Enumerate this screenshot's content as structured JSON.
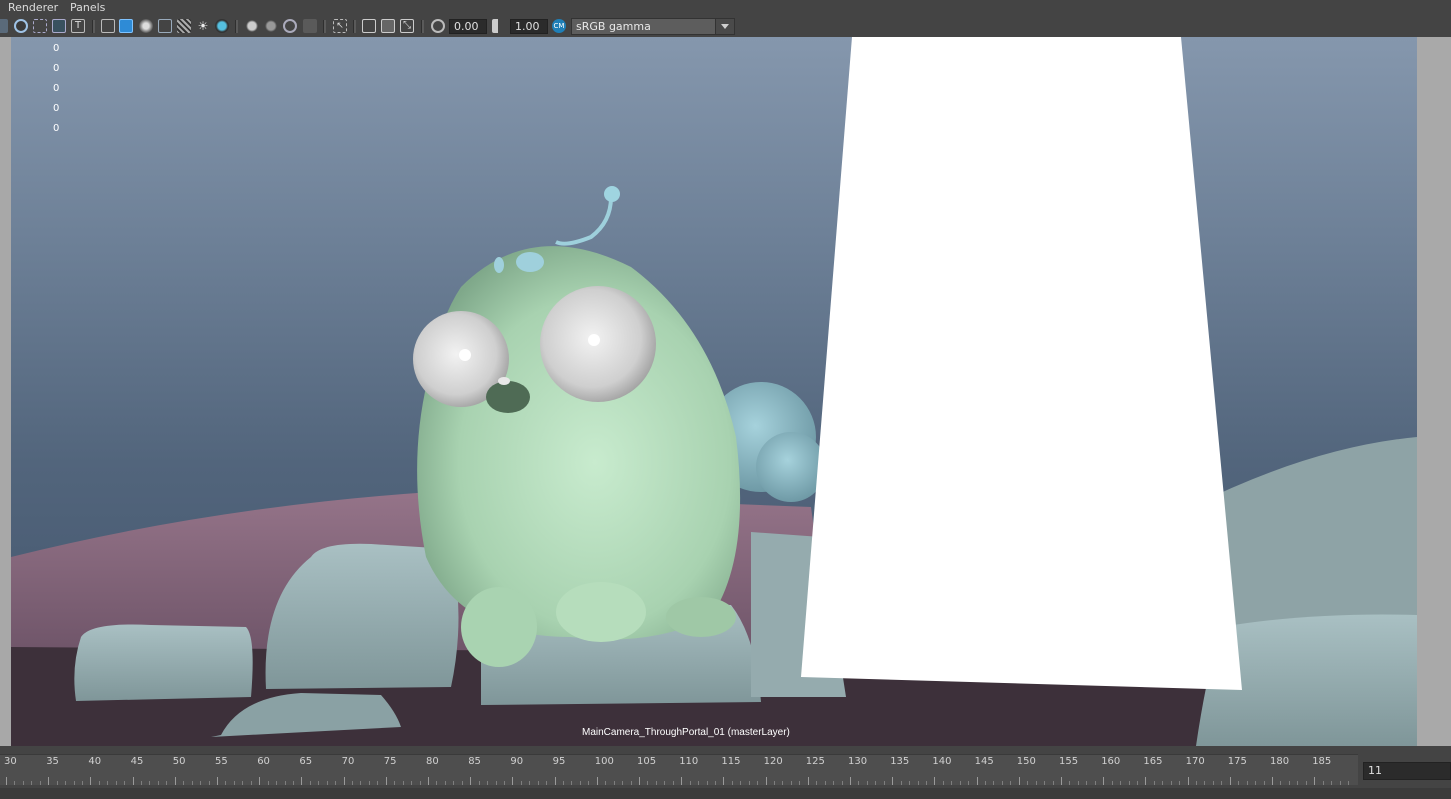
{
  "menu": {
    "items": [
      "Renderer",
      "Panels"
    ]
  },
  "toolbar": {
    "exposure_value": "0.00",
    "gamma_value": "1.00",
    "color_space": "sRGB gamma",
    "icons": [
      "view-transform-icon",
      "wireframe-icon",
      "smooth-shade-icon",
      "bounding-box-icon",
      "points-icon",
      "texture-icon",
      "default-material-icon",
      "xray-icon",
      "lights-icon",
      "shadows-icon",
      "screen-space-ao-icon",
      "motion-blur-icon",
      "anti-alias-icon",
      "depth-of-field-icon",
      "isolate-select-icon",
      "xray-joints-icon",
      "grid-icon",
      "camera-attr-icon",
      "gate-mask-icon",
      "exposure-icon",
      "gamma-icon",
      "color-management-icon"
    ]
  },
  "viewport": {
    "hud_values": [
      "0",
      "0",
      "0",
      "0",
      "0"
    ],
    "camera_label": "MainCamera_ThroughPortal_01 (masterLayer)"
  },
  "timeline": {
    "ticks": [
      "30",
      "35",
      "40",
      "45",
      "50",
      "55",
      "60",
      "65",
      "70",
      "75",
      "80",
      "85",
      "90",
      "95",
      "100",
      "105",
      "110",
      "115",
      "120",
      "125",
      "130",
      "135",
      "140",
      "145",
      "150",
      "155",
      "160",
      "165",
      "170",
      "175",
      "180",
      "185"
    ],
    "current_frame": "11"
  },
  "colors": {
    "character_body": "#bfe3c4",
    "rocks": "#9fb5b9",
    "ground": "#3d303a",
    "pink_hill": "#8f6f86",
    "portal_plane": "#ffffff"
  }
}
